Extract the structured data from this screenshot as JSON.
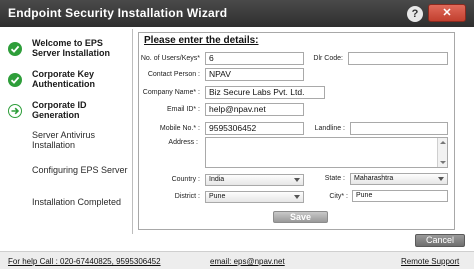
{
  "window": {
    "title": "Endpoint Security Installation Wizard",
    "help_glyph": "?",
    "close_glyph": "✕"
  },
  "steps": [
    {
      "label": "Welcome to EPS Server Installation",
      "status": "done"
    },
    {
      "label": "Corporate Key Authentication",
      "status": "done"
    },
    {
      "label": "Corporate ID Generation",
      "status": "current"
    },
    {
      "label": "Server Antivirus Installation",
      "status": "pending"
    },
    {
      "label": "Configuring EPS Server",
      "status": "pending"
    },
    {
      "label": "Installation Completed",
      "status": "pending"
    }
  ],
  "form": {
    "header": "Please enter the details:",
    "users": {
      "label": "No. of Users/Keys*",
      "value": "6"
    },
    "dlr": {
      "label": "Dlr Code:",
      "value": ""
    },
    "contact": {
      "label": "Contact Person :",
      "value": "NPAV"
    },
    "company": {
      "label": "Company Name* :",
      "value": "Biz Secure Labs Pvt. Ltd."
    },
    "email": {
      "label": "Email ID* :",
      "value": "help@npav.net"
    },
    "mobile": {
      "label": "Mobile No.* :",
      "value": "9595306452"
    },
    "landline": {
      "label": "Landline :",
      "value": ""
    },
    "address": {
      "label": "Address :",
      "value": ""
    },
    "country": {
      "label": "Country :",
      "value": "India"
    },
    "state": {
      "label": "State :",
      "value": "Maharashtra"
    },
    "district": {
      "label": "District :",
      "value": "Pune"
    },
    "city": {
      "label": "City* :",
      "value": "Pune"
    },
    "save_label": "Save"
  },
  "cancel_label": "Cancel",
  "footer": {
    "help_call": "For help Call : 020-67440825, 9595306452",
    "email": "email: eps@npav.net",
    "remote_support": "Remote Support"
  },
  "colors": {
    "titlebar": "#3a3a3a",
    "step_done": "#2e9e3a",
    "close_button": "#c9483a"
  }
}
